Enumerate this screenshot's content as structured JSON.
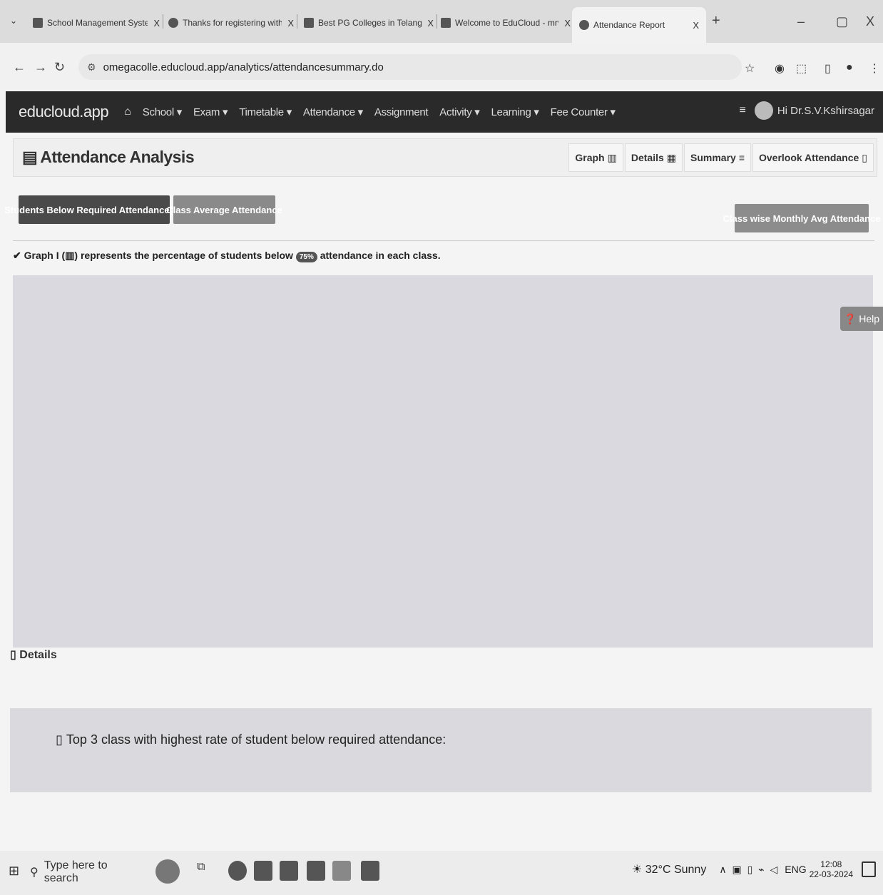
{
  "browser": {
    "tabs": [
      {
        "label": "School Management System | F"
      },
      {
        "label": "Thanks for registering with Edu"
      },
      {
        "label": "Best PG Colleges in Telangana -"
      },
      {
        "label": "Welcome to EduCloud - mrvc"
      },
      {
        "label": "Attendance Report"
      }
    ],
    "close_glyph": "X",
    "new_tab_glyph": "+",
    "url": "omegacolle.educloud.app/analytics/attendancesummary.do"
  },
  "app": {
    "brand": "educloud.app",
    "nav": [
      "School ▾",
      "Exam ▾",
      "Timetable ▾",
      "Attendance ▾",
      "Assignment",
      "Activity ▾",
      "Learning ▾",
      "Fee Counter ▾"
    ],
    "greeting": "Hi Dr.S.V.Kshirsagar"
  },
  "page": {
    "title": "Attendance Analysis",
    "view_tabs": [
      "Graph",
      "Details",
      "Summary",
      "Overlook Attendance"
    ],
    "buttons": {
      "below_required": "Students Below Required Attendance(%)",
      "class_average": "Class Average Attendance",
      "monthly_avg": "Class wise Monthly Avg Attendance"
    },
    "note_prefix": "Graph I (",
    "note_mid": ") represents the percentage of students below",
    "threshold": "75%",
    "note_suffix": "attendance in each class.",
    "help": "Help",
    "details_heading": "Details",
    "top3_text": "Top 3 class with highest rate of student below required attendance:"
  },
  "taskbar": {
    "search_placeholder": "Type here to search",
    "weather": "32°C Sunny",
    "lang": "ENG",
    "time": "12:08",
    "date": "22-03-2024"
  }
}
